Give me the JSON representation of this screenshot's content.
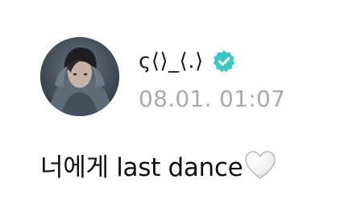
{
  "author": {
    "name": "ς⟨⟩_⟨.⟩",
    "verified": true,
    "verified_color": "#3dc6c4"
  },
  "timestamp": "08.01. 01:07",
  "message": {
    "text": "너에게 last dance",
    "emoji": "white-heart-icon"
  },
  "colors": {
    "background": "#ffffff",
    "text": "#111111",
    "timestamp": "#a9a9a9"
  }
}
